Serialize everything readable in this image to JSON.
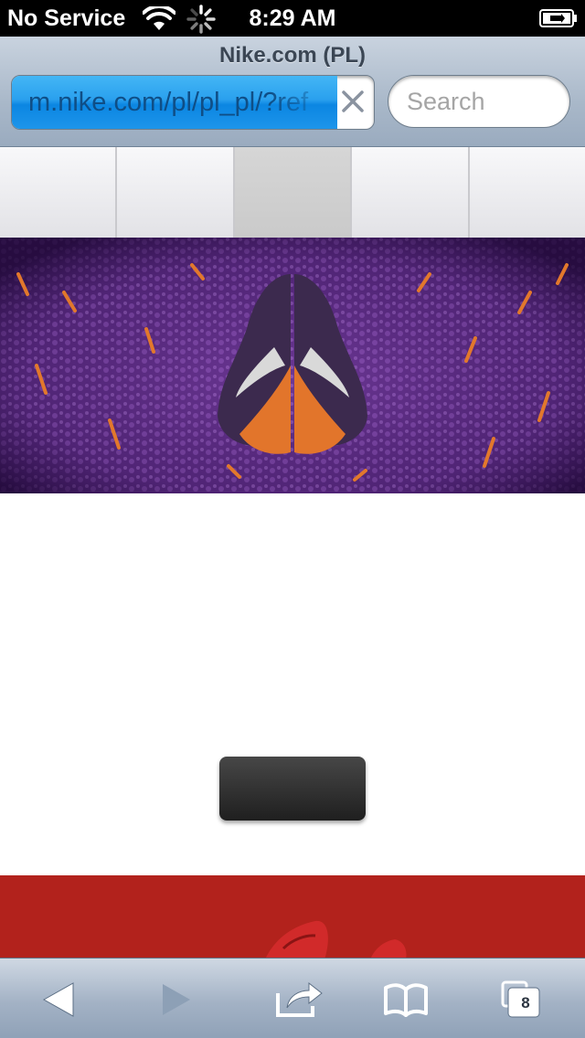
{
  "status_bar": {
    "carrier": "No Service",
    "time": "8:29 AM"
  },
  "browser": {
    "page_title": "Nike.com (PL)",
    "url": "m.nike.com/pl/pl_pl/?ref",
    "url_load_progress": 0.9,
    "search_placeholder": "Search",
    "open_tabs_count": "8"
  },
  "page": {
    "nav_tiles": 5,
    "selected_nav_tile": 3
  },
  "colors": {
    "url_progress": "#1e95ea",
    "promo_banner": "#b2221c",
    "cta_button": "#2b2b2b"
  },
  "icons": {
    "wifi": "wifi-icon",
    "loading": "spinner-icon",
    "battery": "battery-charging-icon",
    "clear": "close-icon",
    "back": "back-arrow-icon",
    "forward": "forward-arrow-icon",
    "share": "share-icon",
    "bookmarks": "book-icon",
    "tabs": "pages-icon"
  }
}
